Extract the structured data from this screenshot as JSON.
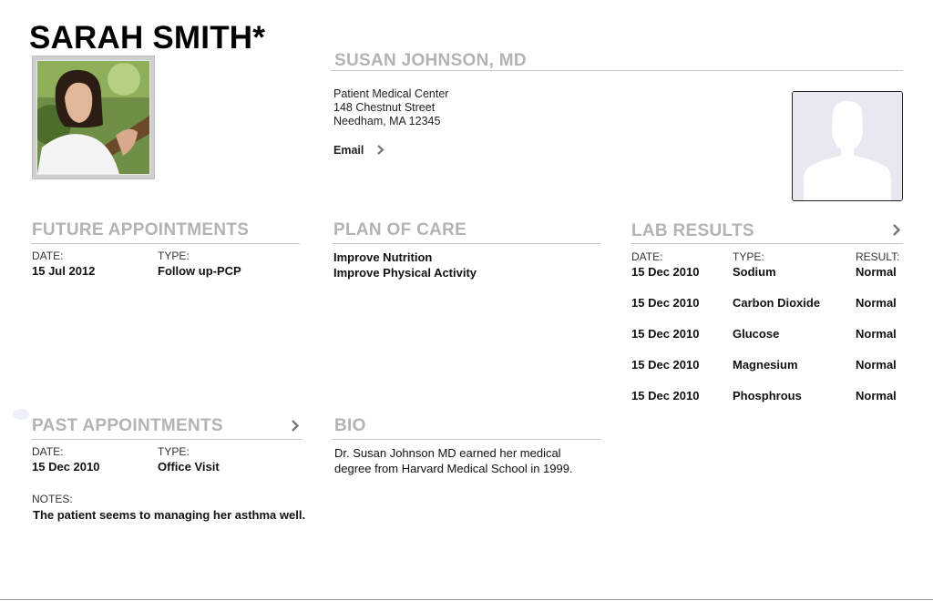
{
  "patient": {
    "name": "SARAH SMITH*"
  },
  "doctor": {
    "name": "SUSAN JOHNSON, MD",
    "address": [
      "Patient Medical Center",
      "148 Chestnut Street",
      "Needham, MA 12345"
    ],
    "email_label": "Email"
  },
  "future_appointments": {
    "title": "FUTURE APPOINTMENTS",
    "date_label": "DATE:",
    "type_label": "TYPE:",
    "items": [
      {
        "date": "15 Jul 2012",
        "type": "Follow up-PCP"
      }
    ]
  },
  "plan_of_care": {
    "title": "PLAN OF CARE",
    "items": [
      "Improve Nutrition",
      "Improve Physical Activity"
    ]
  },
  "lab_results": {
    "title": "LAB RESULTS",
    "date_label": "DATE:",
    "type_label": "TYPE:",
    "result_label": "RESULT:",
    "rows": [
      {
        "date": "15 Dec 2010",
        "type": "Sodium",
        "result": "Normal"
      },
      {
        "date": "15 Dec 2010",
        "type": "Carbon Dioxide",
        "result": "Normal"
      },
      {
        "date": "15 Dec 2010",
        "type": "Glucose",
        "result": "Normal"
      },
      {
        "date": "15 Dec 2010",
        "type": "Magnesium",
        "result": "Normal"
      },
      {
        "date": "15 Dec 2010",
        "type": "Phosphrous",
        "result": "Normal"
      }
    ]
  },
  "past_appointments": {
    "title": "PAST APPOINTMENTS",
    "date_label": "DATE:",
    "type_label": "TYPE:",
    "notes_label": "NOTES:",
    "items": [
      {
        "date": "15 Dec 2010",
        "type": "Office Visit"
      }
    ],
    "notes": "The patient seems to managing her asthma well."
  },
  "bio": {
    "title": "BIO",
    "text": "Dr. Susan Johnson MD earned her medical degree from Harvard Medical School in 1999."
  },
  "icons": {
    "chevron": "chevron-right-icon",
    "avatar_placeholder": "person-silhouette-icon"
  },
  "colors": {
    "section_title": "#b3b3b3",
    "rule": "#c6c6c6",
    "avatar_bg": "#e9e8f0"
  }
}
